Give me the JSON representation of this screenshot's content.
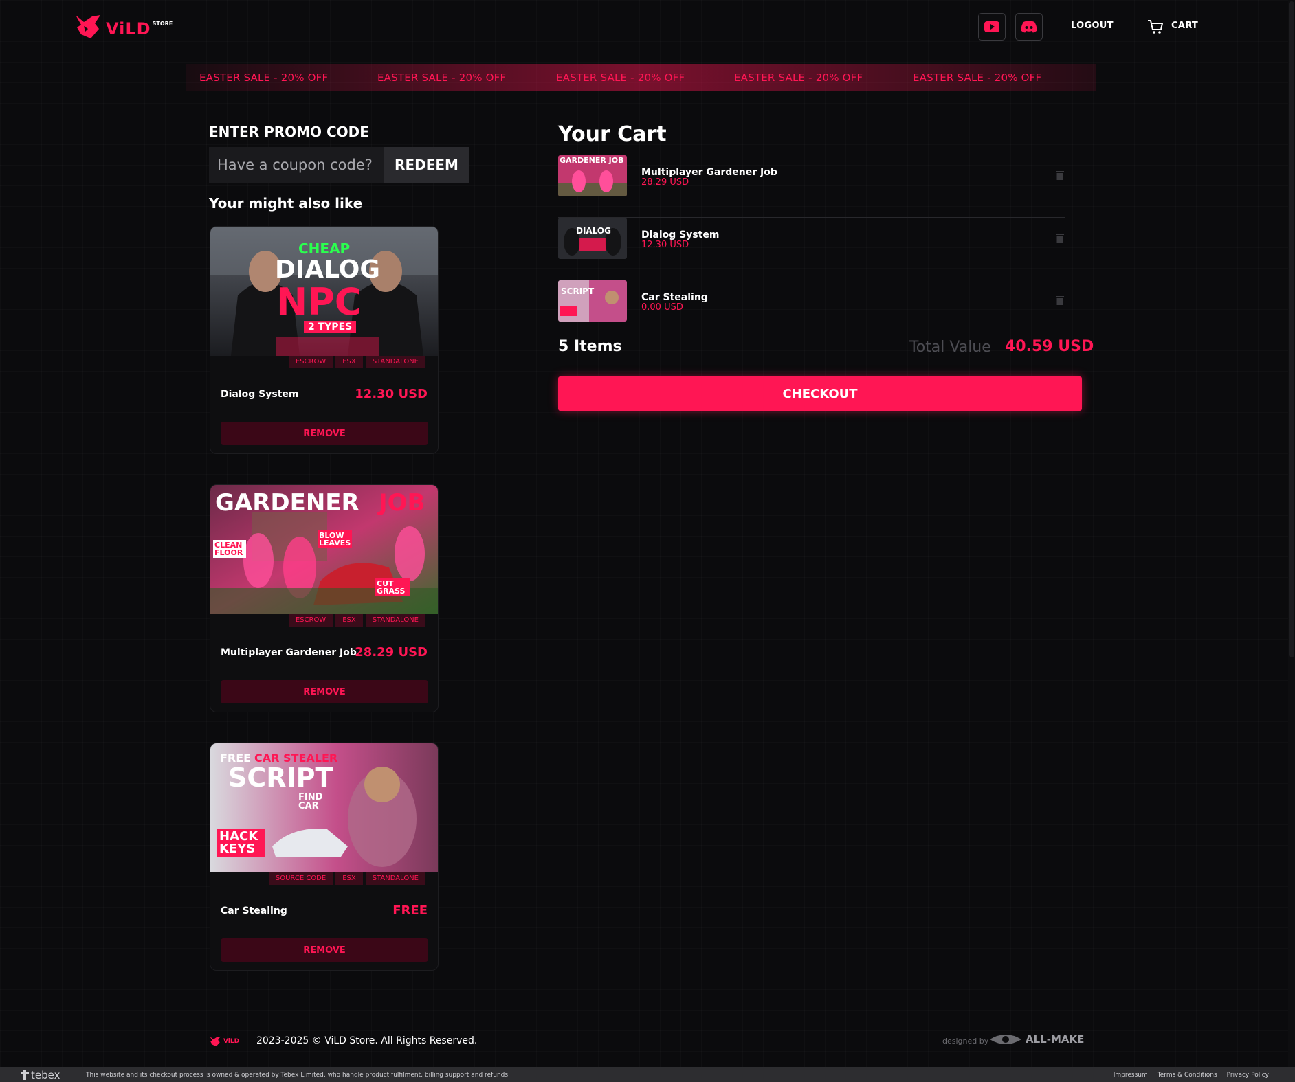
{
  "brand": {
    "name": "ViLD",
    "sup": "STORE"
  },
  "header": {
    "logout": "LOGOUT",
    "cart": "CART",
    "youtube_icon": "youtube-icon",
    "discord_icon": "discord-icon"
  },
  "marquee": [
    "EASTER SALE - 20% OFF",
    "EASTER SALE - 20% OFF",
    "EASTER SALE - 20% OFF",
    "EASTER SALE - 20% OFF",
    "EASTER SALE - 20% OFF"
  ],
  "promo": {
    "title": "ENTER PROMO CODE",
    "placeholder": "Have a coupon code?",
    "redeem": "REDEEM"
  },
  "also_like": {
    "title": "Your might also like",
    "products": [
      {
        "name": "Dialog System",
        "price": "12.30 USD",
        "tags": [
          "ESCROW",
          "ESX",
          "STANDALONE"
        ],
        "remove": "REMOVE",
        "art": {
          "small": "CHEAP",
          "big1": "DIALOG",
          "big2": "NPC",
          "badge": "2 TYPES"
        }
      },
      {
        "name": "Multiplayer Gardener Job",
        "price": "28.29 USD",
        "tags": [
          "ESCROW",
          "ESX",
          "STANDALONE"
        ],
        "remove": "REMOVE",
        "art": {
          "big1": "GARDENER",
          "big2": "JOB",
          "label1": "CLEAN FLOOR",
          "label2": "BLOW LEAVES",
          "label3": "CUT GRASS"
        }
      },
      {
        "name": "Car Stealing",
        "price": "FREE",
        "tags": [
          "SOURCE CODE",
          "ESX",
          "STANDALONE"
        ],
        "remove": "REMOVE",
        "art": {
          "small1": "FREE",
          "small2": "CAR STEALER",
          "big1": "SCRIPT",
          "label1": "FIND CAR",
          "label2": "HACK KEYS"
        }
      }
    ]
  },
  "cart": {
    "title": "Your Cart",
    "items": [
      {
        "name": "Multiplayer Gardener Job",
        "price": "28.29 USD",
        "thumb": "GARDENER JOB"
      },
      {
        "name": "Dialog System",
        "price": "12.30 USD",
        "thumb": "DIALOG"
      },
      {
        "name": "Car Stealing",
        "price": "0.00 USD",
        "thumb": "SCRIPT"
      }
    ],
    "items_count": "5 Items",
    "total_label": "Total Value",
    "total_value": "40.59 USD",
    "checkout": "CHECKOUT"
  },
  "footer": {
    "copyright": "2023-2025 © ViLD Store. All Rights Reserved.",
    "designed_by": "designed by",
    "designer": "ALL-MAKE"
  },
  "tebex": {
    "logo": "tebex",
    "text": "This website and its checkout process is owned & operated by Tebex Limited, who handle product fulfilment, billing support and refunds.",
    "links": [
      "Impressum",
      "Terms & Conditions",
      "Privacy Policy"
    ]
  },
  "colors": {
    "accent": "#ff1654",
    "bg": "#0b0b0d"
  }
}
